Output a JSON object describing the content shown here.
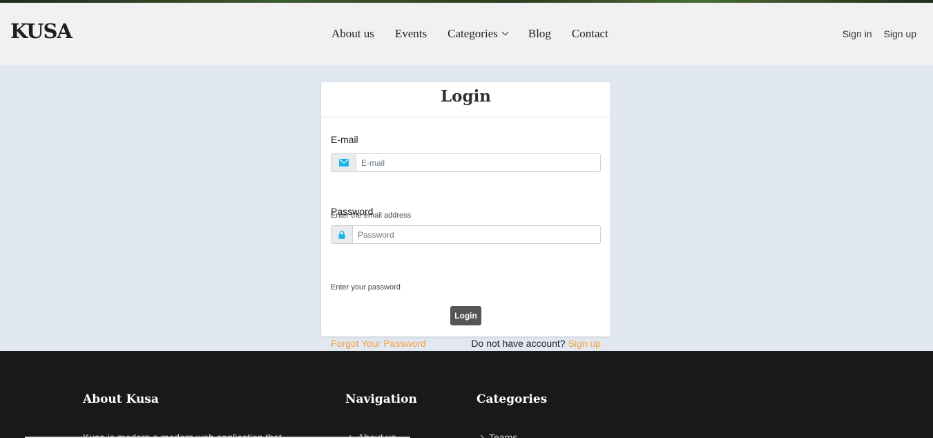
{
  "brand": {
    "logo": "KUSA"
  },
  "nav": {
    "items": [
      {
        "label": "About us"
      },
      {
        "label": "Events"
      },
      {
        "label": "Categories"
      },
      {
        "label": "Blog"
      },
      {
        "label": "Contact"
      }
    ],
    "sign_in": "Sign in",
    "sign_up": "Sign up"
  },
  "login": {
    "title": "Login",
    "email_label": "E-mail",
    "email_placeholder": "E-mail",
    "email_value": "",
    "email_help": "Enter the email address",
    "password_label": "Password",
    "password_placeholder": "Password",
    "password_value": "",
    "password_help": "Enter your password",
    "submit_label": "Login",
    "forgot_label": "Forgot Your Password",
    "no_account_text": "Do not have account?",
    "signup_link": "Sign up"
  },
  "footer": {
    "about_title": "About Kusa",
    "about_text": "Kusa is modern a modern web application that",
    "nav_title": "Navigation",
    "nav_first": "About us",
    "categories_title": "Categories",
    "categories_first": "Teams"
  },
  "icons": {
    "email": "envelope-icon",
    "password": "lock-icon",
    "categories_dropdown": "chevron-down-icon"
  },
  "colors": {
    "accent": "#f4a041",
    "icon_blue": "#17b4e8",
    "button": "#555555",
    "footer_bg": "#17191b",
    "page_bg": "#e2e8f0"
  }
}
